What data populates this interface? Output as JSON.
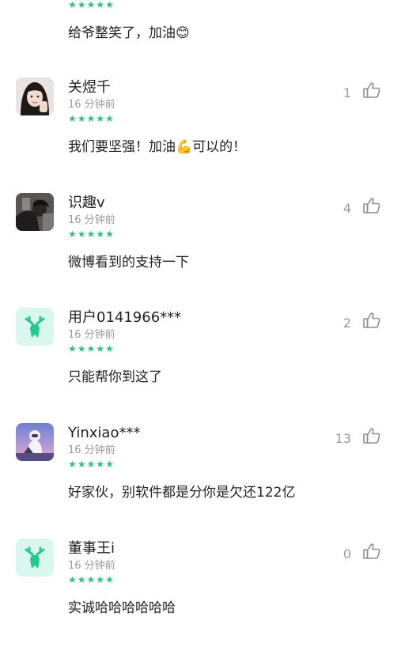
{
  "top_partial": {
    "text": "给爷整笑了，加油😊",
    "stars": 5
  },
  "comments": [
    {
      "user": "关煜千",
      "time": "16 分钟前",
      "text": "我们要坚强！加油💪可以的！",
      "likes": "1",
      "stars": 5,
      "avatar": "photo-girl-avatar"
    },
    {
      "user": "识趣v",
      "time": "16 分钟前",
      "text": "微博看到的支持一下",
      "likes": "4",
      "stars": 5,
      "avatar": "photo-dark-avatar"
    },
    {
      "user": "用户0141966***",
      "time": "16 分钟前",
      "text": "只能帮你到这了",
      "likes": "2",
      "stars": 5,
      "avatar": "deer-default-avatar"
    },
    {
      "user": "Yinxiao***",
      "time": "16 分钟前",
      "text": "好家伙，别软件都是分你是欠还122亿",
      "likes": "13",
      "stars": 5,
      "avatar": "photo-astronaut-avatar"
    },
    {
      "user": "董事王i",
      "time": "16 分钟前",
      "text": "实诚哈哈哈哈哈哈",
      "likes": "0",
      "stars": 5,
      "avatar": "deer-default-avatar"
    }
  ],
  "colors": {
    "star": "#2fc27a",
    "deer_bg": "#d9f7ee",
    "deer": "#27c88f",
    "muted": "#9a9a9a"
  }
}
